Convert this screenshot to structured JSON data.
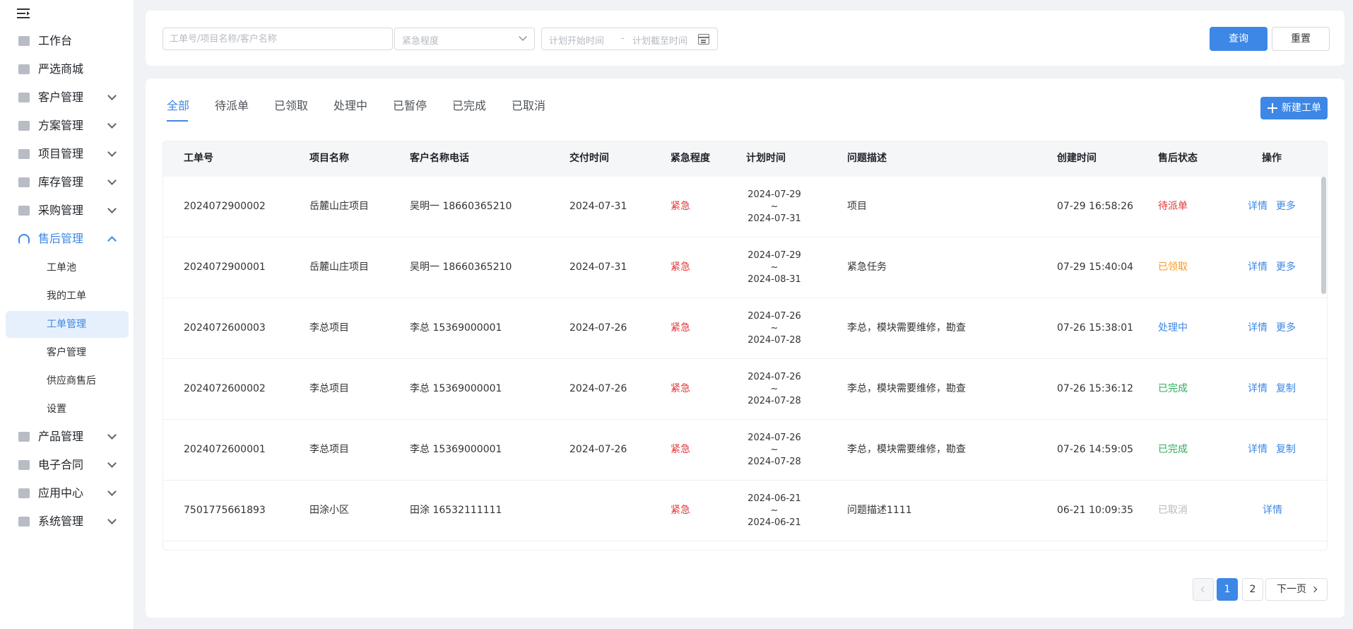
{
  "sidebar": {
    "menu": [
      {
        "label": "工作台",
        "icon": "home-icon",
        "has_children": false
      },
      {
        "label": "严选商城",
        "icon": "mall-icon",
        "has_children": false
      },
      {
        "label": "客户管理",
        "icon": "customer-icon",
        "has_children": true
      },
      {
        "label": "方案管理",
        "icon": "plan-icon",
        "has_children": true
      },
      {
        "label": "项目管理",
        "icon": "folder-icon",
        "has_children": true
      },
      {
        "label": "库存管理",
        "icon": "inventory-icon",
        "has_children": true
      },
      {
        "label": "采购管理",
        "icon": "cart-icon",
        "has_children": true
      },
      {
        "label": "售后管理",
        "icon": "headset-icon",
        "has_children": true,
        "open": true
      },
      {
        "label": "产品管理",
        "icon": "product-icon",
        "has_children": true
      },
      {
        "label": "电子合同",
        "icon": "contract-icon",
        "has_children": true
      },
      {
        "label": "应用中心",
        "icon": "apps-icon",
        "has_children": true
      },
      {
        "label": "系统管理",
        "icon": "gear-icon",
        "has_children": true
      }
    ],
    "submenu": [
      "工单池",
      "我的工单",
      "工单管理",
      "客户管理",
      "供应商售后",
      "设置"
    ],
    "active_submenu": "工单管理"
  },
  "filter": {
    "search_placeholder": "工单号/项目名称/客户名称",
    "urgency_placeholder": "紧急程度",
    "start_placeholder": "计划开始时间",
    "range_separator": "-",
    "end_placeholder": "计划截至时间",
    "query_label": "查询",
    "reset_label": "重置"
  },
  "tabs": [
    "全部",
    "待派单",
    "已领取",
    "处理中",
    "已暂停",
    "已完成",
    "已取消"
  ],
  "active_tab": "全部",
  "new_button_label": "新建工单",
  "table": {
    "columns": [
      "工单号",
      "项目名称",
      "客户名称电话",
      "交付时间",
      "紧急程度",
      "计划时间",
      "问题描述",
      "创建时间",
      "售后状态",
      "操作"
    ],
    "rows": [
      {
        "id": "2024072900002",
        "project": "岳麓山庄项目",
        "customer": "吴明一  18660365210",
        "delivery": "2024-07-31",
        "urgency": "紧急",
        "plan_start": "2024-07-29",
        "plan_sep": "~",
        "plan_end": "2024-07-31",
        "desc": "项目",
        "created": "07-29 16:58:26",
        "status": "待派单",
        "status_color": "#e5383b",
        "op1": "详情",
        "op2": "更多"
      },
      {
        "id": "2024072900001",
        "project": "岳麓山庄项目",
        "customer": "吴明一  18660365210",
        "delivery": "2024-07-31",
        "urgency": "紧急",
        "plan_start": "2024-07-29",
        "plan_sep": "~",
        "plan_end": "2024-08-31",
        "desc": "紧急任务",
        "created": "07-29 15:40:04",
        "status": "已领取",
        "status_color": "#f59a23",
        "op1": "详情",
        "op2": "更多"
      },
      {
        "id": "2024072600003",
        "project": "李总项目",
        "customer": "李总  15369000001",
        "delivery": "2024-07-26",
        "urgency": "紧急",
        "plan_start": "2024-07-26",
        "plan_sep": "~",
        "plan_end": "2024-07-28",
        "desc": "李总，模块需要维修，勘查",
        "created": "07-26 15:38:01",
        "status": "处理中",
        "status_color": "#3d87e6",
        "op1": "详情",
        "op2": "更多"
      },
      {
        "id": "2024072600002",
        "project": "李总项目",
        "customer": "李总  15369000001",
        "delivery": "2024-07-26",
        "urgency": "紧急",
        "plan_start": "2024-07-26",
        "plan_sep": "~",
        "plan_end": "2024-07-28",
        "desc": "李总，模块需要维修，勘查",
        "created": "07-26 15:36:12",
        "status": "已完成",
        "status_color": "#2fab5e",
        "op1": "详情",
        "op2": "复制"
      },
      {
        "id": "2024072600001",
        "project": "李总项目",
        "customer": "李总  15369000001",
        "delivery": "2024-07-26",
        "urgency": "紧急",
        "plan_start": "2024-07-26",
        "plan_sep": "~",
        "plan_end": "2024-07-28",
        "desc": "李总，模块需要维修，勘查",
        "created": "07-26 14:59:05",
        "status": "已完成",
        "status_color": "#2fab5e",
        "op1": "详情",
        "op2": "复制"
      },
      {
        "id": "7501775661893",
        "project": "田涂小区",
        "customer": "田涂  16532111111",
        "delivery": "",
        "urgency": "紧急",
        "plan_start": "2024-06-21",
        "plan_sep": "~",
        "plan_end": "2024-06-21",
        "desc": "问题描述1111",
        "created": "06-21 10:09:35",
        "status": "已取消",
        "status_color": "#b5b9c0",
        "op1": "详情",
        "op2": ""
      }
    ]
  },
  "pagination": {
    "pages": [
      "1",
      "2"
    ],
    "current": "1",
    "next_label": "下一页"
  },
  "colors": {
    "accent": "#3d87e6",
    "urgent": "#e5383b",
    "background": "#f0f2f5"
  }
}
